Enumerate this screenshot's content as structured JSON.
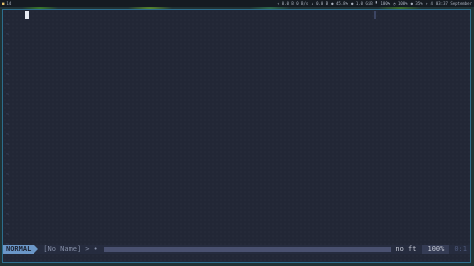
{
  "topbar": {
    "left": [
      "■",
      "14"
    ],
    "right": [
      "↑ 0.0 B  0 B/s",
      "↓ 0.0 B",
      "● 45.8%",
      "● 1.0 GiB",
      "▘ 100%",
      "◔ 100%",
      "● 35%",
      "↑ 4",
      "03:37 September"
    ]
  },
  "editor": {
    "empty_line_marker": "~",
    "line_count": 23
  },
  "statusline": {
    "mode": "NORMAL",
    "filename": "[No Name]",
    "separator": ">",
    "branch": "•",
    "filetype": "no ft",
    "percent": "100%",
    "position": "0:1"
  }
}
